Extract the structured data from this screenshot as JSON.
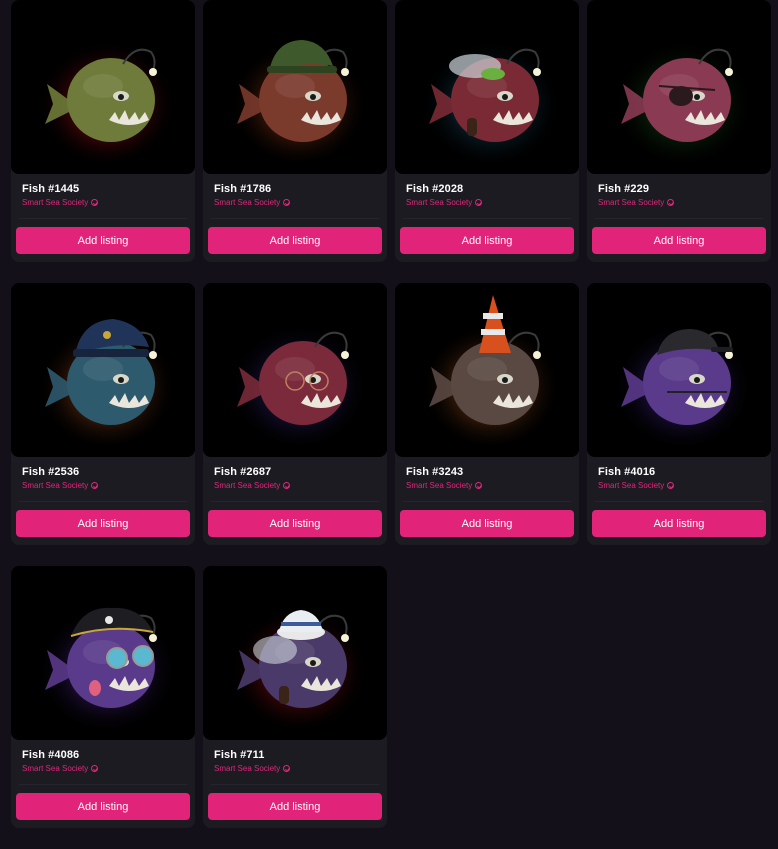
{
  "collection_name": "Smart Sea Society",
  "button_label": "Add listing",
  "accent_color": "#e2237a",
  "cards": [
    {
      "name": "Fish #1445",
      "glow": "#c0121a",
      "body": "#6e7b3a",
      "accessory": "none"
    },
    {
      "name": "Fish #1786",
      "glow": "#a8401a",
      "body": "#7a3a2c",
      "accessory": "army-helmet"
    },
    {
      "name": "Fish #2028",
      "glow": "#1c5a78",
      "body": "#7a2a34",
      "accessory": "smoke-pipe"
    },
    {
      "name": "Fish #229",
      "glow": "#1e5a1e",
      "body": "#8a3a52",
      "accessory": "eye-patch"
    },
    {
      "name": "Fish #2536",
      "glow": "#b0501c",
      "body": "#2e5a6e",
      "accessory": "police-cap"
    },
    {
      "name": "Fish #2687",
      "glow": "#3a2a8a",
      "body": "#7a2a3a",
      "accessory": "glasses"
    },
    {
      "name": "Fish #3243",
      "glow": "#b0561c",
      "body": "#5a4842",
      "accessory": "traffic-cone"
    },
    {
      "name": "Fish #4016",
      "glow": "#4a2aa0",
      "body": "#5a3a8a",
      "accessory": "cap"
    },
    {
      "name": "Fish #4086",
      "glow": "#5a2aa0",
      "body": "#5a3a8a",
      "accessory": "pirate-hat"
    },
    {
      "name": "Fish #711",
      "glow": "#b01414",
      "body": "#4a3a6a",
      "accessory": "sailor-hat"
    }
  ]
}
